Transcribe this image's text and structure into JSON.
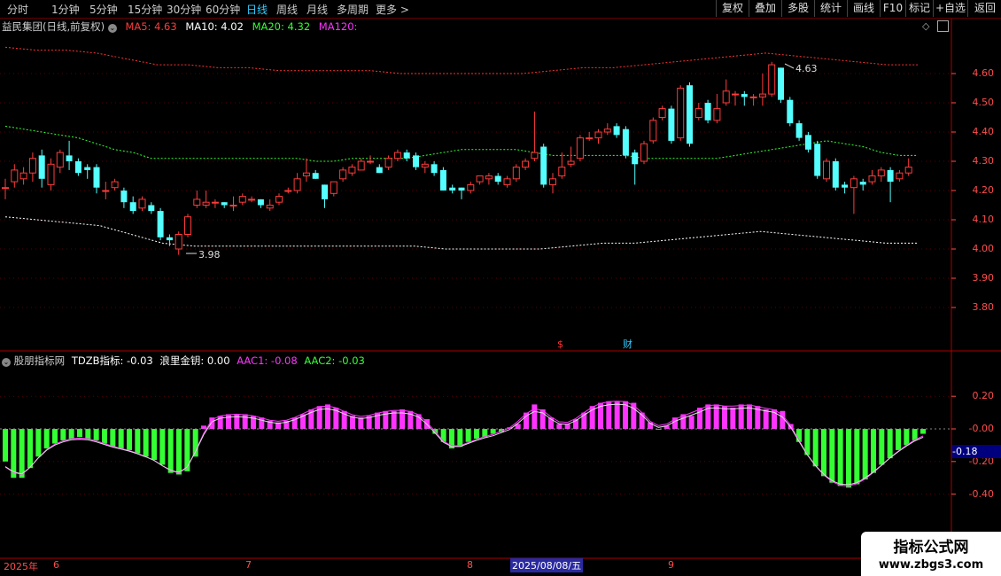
{
  "toolbar": {
    "periods": [
      "分时",
      "1分钟",
      "5分钟",
      "15分钟",
      "30分钟",
      "60分钟",
      "日线",
      "周线",
      "月线",
      "多周期",
      "更多 >"
    ],
    "active_period": "日线",
    "right_buttons": [
      "复权",
      "叠加",
      "多股",
      "统计",
      "画线",
      "F10",
      "标记",
      "+自选",
      "返回"
    ]
  },
  "main": {
    "stock_title": "益民集团(日线,前复权)",
    "ma5": "MA5: 4.63",
    "ma10": "MA10: 4.02",
    "ma20": "MA20: 4.32",
    "ma120": "MA120:",
    "high_label": "4.63",
    "low_label": "3.98",
    "price_ticks": [
      "4.60",
      "4.50",
      "4.40",
      "4.30",
      "4.20",
      "4.10",
      "4.00",
      "3.90",
      "3.80"
    ],
    "markers": [
      "$",
      "财"
    ]
  },
  "indicator": {
    "title": "股朋指标网",
    "tdzb": "TDZB指标: -0.03",
    "lljy": "浪里金钥: 0.00",
    "aac1": "AAC1: -0.08",
    "aac2": "AAC2: -0.03",
    "ticks": [
      "0.20",
      "-0.00",
      "-0.20",
      "-0.40"
    ],
    "current_value": "-0.18"
  },
  "dates": {
    "year": "2025年",
    "month6": "6",
    "month7": "7",
    "month8": "8",
    "selected": "2025/08/08/五",
    "month9": "9"
  },
  "watermark": {
    "title": "指标公式网",
    "url": "www.zbgs3.com"
  },
  "colors": {
    "up": "#ff3b3b",
    "down": "#54ffff",
    "positive_bar": "#ff33ff",
    "negative_bar": "#33ff33",
    "axis": "#ff4d4d",
    "ma20": "#33ff33",
    "ma120": "#ff3333"
  },
  "chart_data": {
    "type": "candlestick",
    "price_candles": [
      [
        4.21,
        4.21,
        4.17,
        4.24
      ],
      [
        4.23,
        4.27,
        4.21,
        4.29
      ],
      [
        4.24,
        4.26,
        4.22,
        4.28
      ],
      [
        4.26,
        4.31,
        4.23,
        4.33
      ],
      [
        4.32,
        4.24,
        4.21,
        4.34
      ],
      [
        4.22,
        4.29,
        4.2,
        4.31
      ],
      [
        4.28,
        4.33,
        4.26,
        4.34
      ],
      [
        4.32,
        4.3,
        4.27,
        4.37
      ],
      [
        4.3,
        4.26,
        4.25,
        4.31
      ],
      [
        4.28,
        4.27,
        4.24,
        4.29
      ],
      [
        4.28,
        4.21,
        4.19,
        4.29
      ],
      [
        4.2,
        4.2,
        4.17,
        4.23
      ],
      [
        4.21,
        4.23,
        4.2,
        4.24
      ],
      [
        4.2,
        4.16,
        4.14,
        4.21
      ],
      [
        4.16,
        4.13,
        4.12,
        4.18
      ],
      [
        4.14,
        4.17,
        4.13,
        4.18
      ],
      [
        4.15,
        4.13,
        4.12,
        4.16
      ],
      [
        4.13,
        4.04,
        4.03,
        4.14
      ],
      [
        4.04,
        4.03,
        4.01,
        4.05
      ],
      [
        4.0,
        4.05,
        3.98,
        4.06
      ],
      [
        4.05,
        4.11,
        4.04,
        4.12
      ],
      [
        4.15,
        4.17,
        4.14,
        4.2
      ],
      [
        4.15,
        4.16,
        4.14,
        4.2
      ],
      [
        4.16,
        4.16,
        4.14,
        4.17
      ],
      [
        4.16,
        4.15,
        4.14,
        4.16
      ],
      [
        4.15,
        4.15,
        4.13,
        4.18
      ],
      [
        4.16,
        4.18,
        4.15,
        4.19
      ],
      [
        4.17,
        4.17,
        4.16,
        4.18
      ],
      [
        4.17,
        4.15,
        4.14,
        4.17
      ],
      [
        4.14,
        4.15,
        4.13,
        4.17
      ],
      [
        4.16,
        4.18,
        4.15,
        4.19
      ],
      [
        4.2,
        4.2,
        4.19,
        4.21
      ],
      [
        4.2,
        4.24,
        4.19,
        4.26
      ],
      [
        4.25,
        4.26,
        4.23,
        4.31
      ],
      [
        4.26,
        4.24,
        4.24,
        4.27
      ],
      [
        4.22,
        4.17,
        4.14,
        4.22
      ],
      [
        4.19,
        4.23,
        4.18,
        4.23
      ],
      [
        4.24,
        4.27,
        4.23,
        4.28
      ],
      [
        4.26,
        4.28,
        4.25,
        4.29
      ],
      [
        4.27,
        4.3,
        4.27,
        4.31
      ],
      [
        4.3,
        4.3,
        4.29,
        4.32
      ],
      [
        4.28,
        4.26,
        4.26,
        4.29
      ],
      [
        4.28,
        4.31,
        4.27,
        4.32
      ],
      [
        4.31,
        4.33,
        4.3,
        4.34
      ],
      [
        4.33,
        4.31,
        4.3,
        4.34
      ],
      [
        4.32,
        4.28,
        4.27,
        4.33
      ],
      [
        4.28,
        4.29,
        4.26,
        4.3
      ],
      [
        4.29,
        4.26,
        4.25,
        4.3
      ],
      [
        4.27,
        4.2,
        4.2,
        4.28
      ],
      [
        4.21,
        4.2,
        4.19,
        4.22
      ],
      [
        4.21,
        4.2,
        4.17,
        4.21
      ],
      [
        4.2,
        4.22,
        4.19,
        4.23
      ],
      [
        4.23,
        4.25,
        4.22,
        4.25
      ],
      [
        4.24,
        4.25,
        4.22,
        4.26
      ],
      [
        4.25,
        4.23,
        4.22,
        4.26
      ],
      [
        4.22,
        4.24,
        4.21,
        4.25
      ],
      [
        4.24,
        4.28,
        4.23,
        4.29
      ],
      [
        4.28,
        4.3,
        4.27,
        4.31
      ],
      [
        4.31,
        4.33,
        4.3,
        4.47
      ],
      [
        4.35,
        4.22,
        4.21,
        4.36
      ],
      [
        4.22,
        4.24,
        4.19,
        4.26
      ],
      [
        4.25,
        4.28,
        4.24,
        4.33
      ],
      [
        4.29,
        4.3,
        4.28,
        4.35
      ],
      [
        4.31,
        4.38,
        4.3,
        4.39
      ],
      [
        4.38,
        4.38,
        4.37,
        4.4
      ],
      [
        4.38,
        4.4,
        4.36,
        4.41
      ],
      [
        4.4,
        4.41,
        4.39,
        4.43
      ],
      [
        4.42,
        4.39,
        4.38,
        4.43
      ],
      [
        4.41,
        4.32,
        4.31,
        4.42
      ],
      [
        4.33,
        4.29,
        4.22,
        4.34
      ],
      [
        4.3,
        4.36,
        4.29,
        4.37
      ],
      [
        4.37,
        4.44,
        4.36,
        4.45
      ],
      [
        4.45,
        4.48,
        4.44,
        4.49
      ],
      [
        4.48,
        4.37,
        4.36,
        4.49
      ],
      [
        4.38,
        4.55,
        4.37,
        4.56
      ],
      [
        4.56,
        4.36,
        4.35,
        4.57
      ],
      [
        4.45,
        4.48,
        4.44,
        4.5
      ],
      [
        4.5,
        4.44,
        4.43,
        4.51
      ],
      [
        4.44,
        4.48,
        4.43,
        4.53
      ],
      [
        4.5,
        4.54,
        4.49,
        4.58
      ],
      [
        4.53,
        4.53,
        4.49,
        4.54
      ],
      [
        4.53,
        4.52,
        4.49,
        4.54
      ],
      [
        4.52,
        4.52,
        4.49,
        4.53
      ],
      [
        4.52,
        4.53,
        4.49,
        4.6
      ],
      [
        4.53,
        4.63,
        4.52,
        4.64
      ],
      [
        4.62,
        4.51,
        4.5,
        4.62
      ],
      [
        4.51,
        4.43,
        4.42,
        4.52
      ],
      [
        4.43,
        4.38,
        4.37,
        4.44
      ],
      [
        4.39,
        4.34,
        4.33,
        4.4
      ],
      [
        4.36,
        4.25,
        4.24,
        4.37
      ],
      [
        4.24,
        4.3,
        4.23,
        4.31
      ],
      [
        4.3,
        4.21,
        4.2,
        4.31
      ],
      [
        4.22,
        4.21,
        4.19,
        4.23
      ],
      [
        4.21,
        4.24,
        4.12,
        4.25
      ],
      [
        4.23,
        4.22,
        4.2,
        4.24
      ],
      [
        4.23,
        4.25,
        4.22,
        4.27
      ],
      [
        4.25,
        4.27,
        4.23,
        4.28
      ],
      [
        4.27,
        4.23,
        4.16,
        4.28
      ],
      [
        4.24,
        4.26,
        4.23,
        4.27
      ],
      [
        4.26,
        4.28,
        4.25,
        4.31
      ]
    ],
    "ma20": [
      4.42,
      4.41,
      4.4,
      4.39,
      4.38,
      4.36,
      4.34,
      4.33,
      4.31,
      4.31,
      4.31,
      4.31,
      4.31,
      4.31,
      4.31,
      4.31,
      4.31,
      4.3,
      4.3,
      4.31,
      4.31,
      4.31,
      4.31,
      4.32,
      4.33,
      4.34,
      4.34,
      4.34,
      4.34,
      4.33,
      4.32,
      4.32,
      4.32,
      4.32,
      4.32,
      4.31,
      4.31,
      4.31,
      4.31,
      4.31,
      4.32,
      4.33,
      4.34,
      4.35,
      4.36,
      4.37,
      4.36,
      4.35,
      4.33,
      4.32,
      4.32
    ],
    "ma120": [
      4.69,
      4.68,
      4.68,
      4.67,
      4.65,
      4.63,
      4.63,
      4.62,
      4.62,
      4.61,
      4.61,
      4.61,
      4.61,
      4.6,
      4.6,
      4.6,
      4.6,
      4.6,
      4.61,
      4.62,
      4.62,
      4.63,
      4.64,
      4.65,
      4.66,
      4.67,
      4.66,
      4.65,
      4.64,
      4.63,
      4.63
    ],
    "ma_low": [
      4.11,
      4.1,
      4.09,
      4.08,
      4.05,
      4.02,
      4.01,
      4.01,
      4.01,
      4.01,
      4.01,
      4.01,
      4.01,
      4.01,
      4.0,
      4.0,
      4.0,
      4.0,
      4.01,
      4.02,
      4.02,
      4.03,
      4.04,
      4.05,
      4.06,
      4.05,
      4.04,
      4.03,
      4.02,
      4.02
    ],
    "indicator_bars": [
      -0.2,
      -0.3,
      -0.3,
      -0.24,
      -0.17,
      -0.12,
      -0.09,
      -0.07,
      -0.06,
      -0.05,
      -0.06,
      -0.07,
      -0.09,
      -0.11,
      -0.12,
      -0.13,
      -0.15,
      -0.17,
      -0.19,
      -0.22,
      -0.27,
      -0.28,
      -0.26,
      -0.17,
      0.02,
      0.07,
      0.08,
      0.09,
      0.09,
      0.09,
      0.08,
      0.07,
      0.05,
      0.04,
      0.05,
      0.07,
      0.09,
      0.12,
      0.14,
      0.15,
      0.13,
      0.11,
      0.08,
      0.07,
      0.08,
      0.1,
      0.11,
      0.11,
      0.12,
      0.11,
      0.09,
      0.06,
      -0.03,
      -0.08,
      -0.12,
      -0.11,
      -0.08,
      -0.06,
      -0.05,
      -0.03,
      -0.02,
      0.01,
      0.03,
      0.1,
      0.15,
      0.12,
      0.07,
      0.03,
      0.03,
      0.06,
      0.1,
      0.14,
      0.16,
      0.17,
      0.17,
      0.17,
      0.16,
      0.1,
      0.04,
      0.0,
      0.02,
      0.07,
      0.09,
      0.08,
      0.13,
      0.15,
      0.15,
      0.14,
      0.13,
      0.15,
      0.15,
      0.14,
      0.12,
      0.12,
      0.11,
      0.03,
      -0.08,
      -0.16,
      -0.23,
      -0.29,
      -0.33,
      -0.35,
      -0.36,
      -0.34,
      -0.31,
      -0.27,
      -0.22,
      -0.18,
      -0.13,
      -0.1,
      -0.07,
      -0.03
    ]
  }
}
